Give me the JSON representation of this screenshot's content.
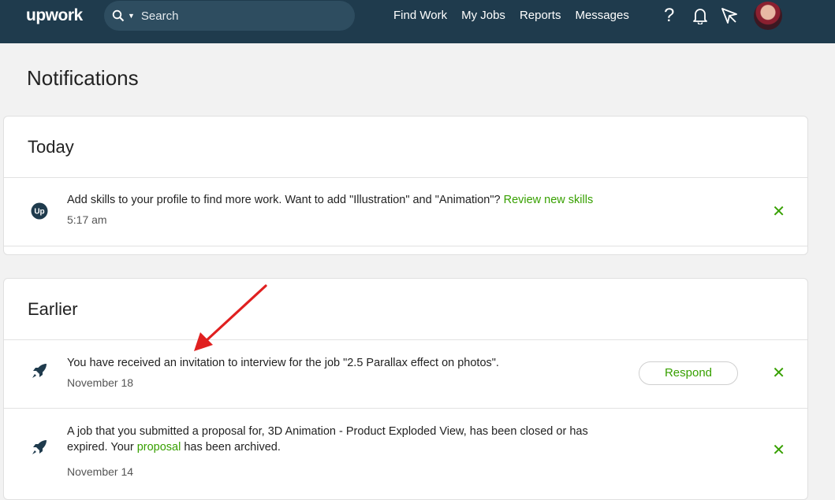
{
  "header": {
    "logo": "upwork",
    "search_placeholder": "Search",
    "nav": [
      "Find Work",
      "My Jobs",
      "Reports",
      "Messages"
    ],
    "help": "?"
  },
  "page": {
    "title": "Notifications"
  },
  "today": {
    "title": "Today",
    "items": [
      {
        "icon": "upwork-logo-icon",
        "text": "Add skills to your profile to find more work. Want to add \"Illustration\" and \"Animation\"?",
        "link": "Review new skills",
        "date": "5:17 am"
      }
    ]
  },
  "earlier": {
    "title": "Earlier",
    "items": [
      {
        "icon": "rocket-icon",
        "text": "You have received an invitation to interview for the job \"2.5 Parallax effect on photos\".",
        "action": "Respond",
        "date": "November 18"
      },
      {
        "icon": "rocket-icon",
        "text_line1": "A job that you submitted a proposal for, 3D Animation - Product Exploded View, has been closed or has",
        "text_line2_pre": "expired. Your",
        "link": "proposal",
        "text_line2_post": "has been archived.",
        "date": "November 14"
      }
    ]
  },
  "close_symbol": "✕",
  "colors": {
    "header": "#1f3b4d",
    "accent": "#37a000",
    "annotation": "#e02020"
  }
}
